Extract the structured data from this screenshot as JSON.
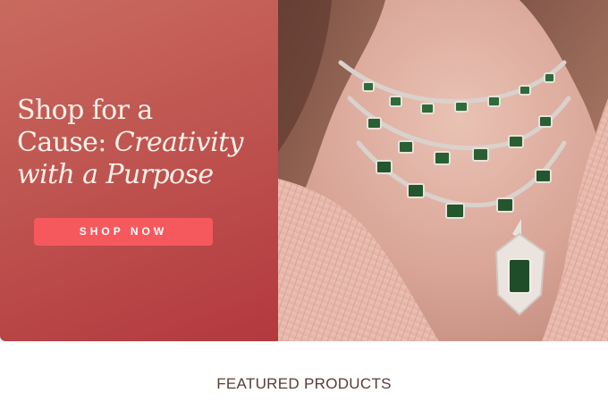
{
  "hero": {
    "title_line1": "Shop for a",
    "title_line2_plain": "Cause: ",
    "title_line2_accent": "Creativity",
    "title_line3_accent": "with a Purpose",
    "button_label": "SHOP NOW"
  },
  "featured": {
    "heading": "FEATURED PRODUCTS"
  },
  "colors": {
    "hero_panel": "#bf5550",
    "button": "#f6595d",
    "title_text": "#fbf1ea",
    "heading_text": "#5b3a33"
  }
}
